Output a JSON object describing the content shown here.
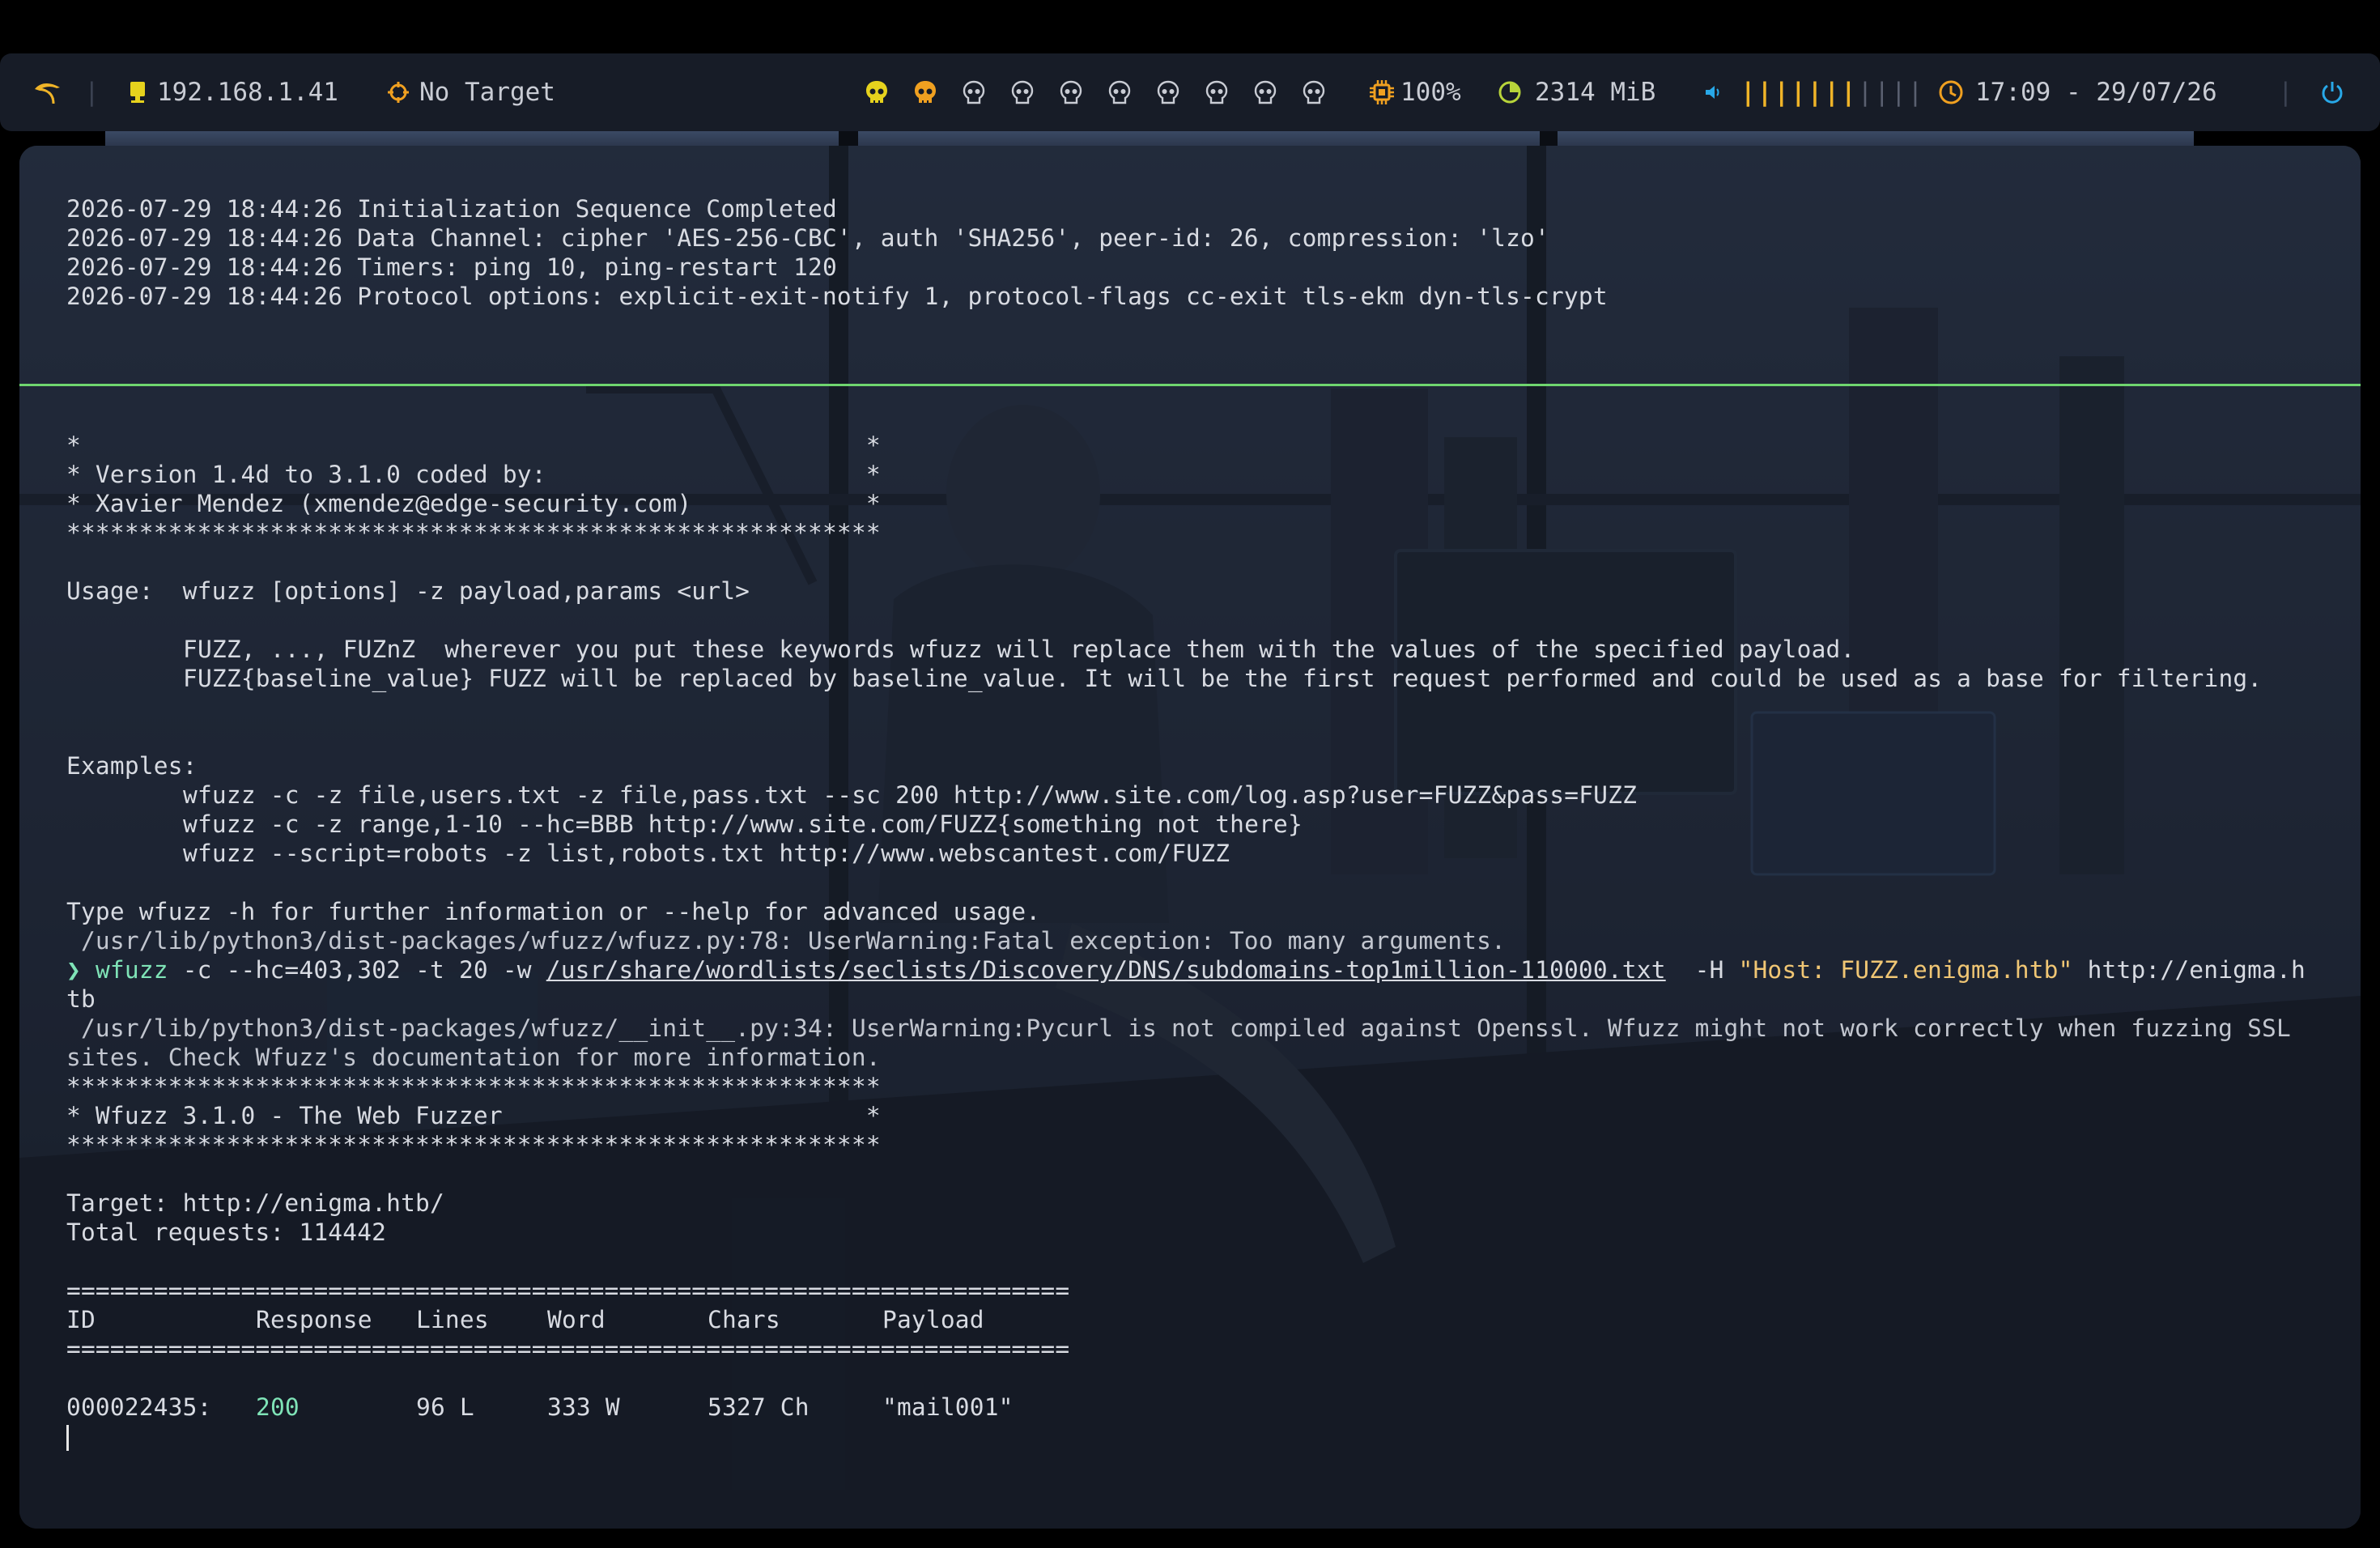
{
  "topbar": {
    "ip": "192.168.1.41",
    "target": "No Target",
    "cpu": "100%",
    "memory": "2314 MiB",
    "volume_bars": "|||||||",
    "volume_bars_off": "||||",
    "clock": "17:09 - 29/07/26",
    "divider": "|",
    "colors": {
      "active_skull": "#e6d21d",
      "second_skull": "#f0a020",
      "accent": "#f0a020",
      "power": "#28a8e8"
    },
    "icons": [
      "kali-dragon-icon",
      "monitor-icon",
      "crosshair-icon",
      "skull-icon",
      "cpu-icon",
      "memory-icon",
      "speaker-icon",
      "clock-icon",
      "power-icon"
    ]
  },
  "terminal_top": {
    "lines": [
      "2026-07-29 18:44:26 Initialization Sequence Completed",
      "2026-07-29 18:44:26 Data Channel: cipher 'AES-256-CBC', auth 'SHA256', peer-id: 26, compression: 'lzo'",
      "2026-07-29 18:44:26 Timers: ping 10, ping-restart 120",
      "2026-07-29 18:44:26 Protocol options: explicit-exit-notify 1, protocol-flags cc-exit tls-ekm dyn-tls-crypt"
    ]
  },
  "terminal_bottom": {
    "banner1": [
      "*                                                      *",
      "* Version 1.4d to 3.1.0 coded by:                      *",
      "* Xavier Mendez (xmendez@edge-security.com)            *",
      "********************************************************"
    ],
    "usage": "Usage:  wfuzz [options] -z payload,params <url>",
    "usage_desc": [
      "FUZZ, ..., FUZnZ  wherever you put these keywords wfuzz will replace them with the values of the specified payload.",
      "FUZZ{baseline_value} FUZZ will be replaced by baseline_value. It will be the first request performed and could be used as a base for filtering."
    ],
    "examples_label": "Examples:",
    "examples": [
      "wfuzz -c -z file,users.txt -z file,pass.txt --sc 200 http://www.site.com/log.asp?user=FUZZ&pass=FUZZ",
      "wfuzz -c -z range,1-10 --hc=BBB http://www.site.com/FUZZ{something not there}",
      "wfuzz --script=robots -z list,robots.txt http://www.webscantest.com/FUZZ"
    ],
    "help_line": "Type wfuzz -h for further information or --help for advanced usage.",
    "warning1": " /usr/lib/python3/dist-packages/wfuzz/wfuzz.py:78: UserWarning:Fatal exception: Too many arguments.",
    "prompt_symbol": "❯",
    "cmd_name": "wfuzz",
    "cmd_args": " -c --hc=403,302 -t 20 -w ",
    "cmd_wordlist": "/usr/share/wordlists/seclists/Discovery/DNS/subdomains-top1million-110000.txt",
    "cmd_header_flag": "  -H ",
    "cmd_header_value": "\"Host: FUZZ.enigma.htb\"",
    "cmd_url": " http://enigma.h",
    "cmd_wrap": "tb",
    "warning2": [
      " /usr/lib/python3/dist-packages/wfuzz/__init__.py:34: UserWarning:Pycurl is not compiled against Openssl. Wfuzz might not work correctly when fuzzing SSL",
      "sites. Check Wfuzz's documentation for more information."
    ],
    "banner2": [
      "********************************************************",
      "* Wfuzz 3.1.0 - The Web Fuzzer                         *",
      "********************************************************"
    ],
    "target": "Target: http://enigma.htb/",
    "total": "Total requests: 114442",
    "rule": "=====================================================================",
    "columns": [
      "ID",
      "Response",
      "Lines",
      "Word",
      "Chars",
      "Payload"
    ],
    "result": {
      "id": "000022435:",
      "response": "200",
      "lines": "96 L",
      "word": "333 W",
      "chars": "5327 Ch",
      "payload": "\"mail001\""
    }
  }
}
